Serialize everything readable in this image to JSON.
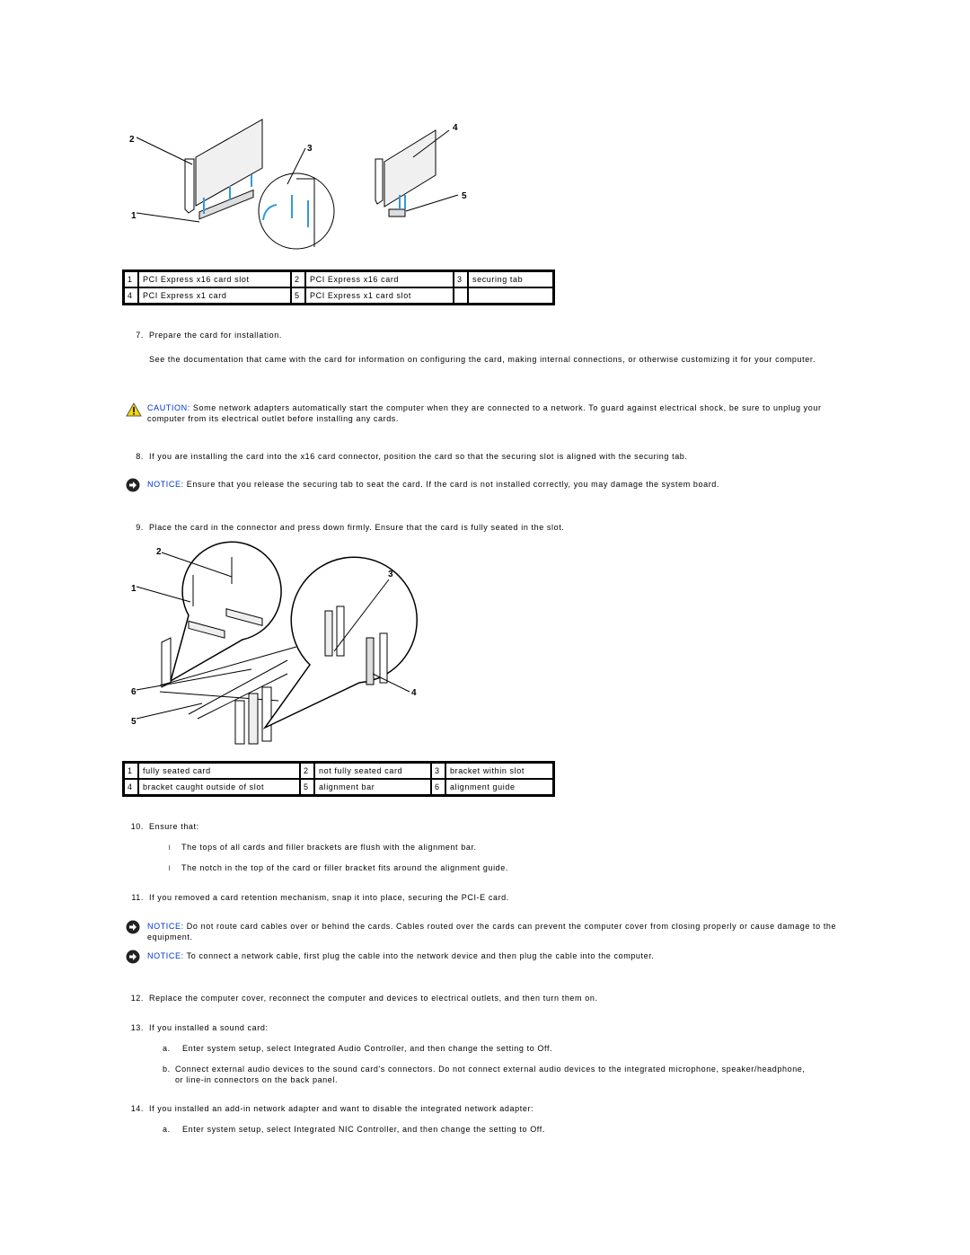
{
  "figure1": {
    "alt": "PCI Express x16 and x1 card installation diagram",
    "callouts": [
      "1",
      "2",
      "3",
      "4",
      "5"
    ]
  },
  "table1": {
    "rows": [
      [
        {
          "num": "1",
          "label": "PCI Express x16 card slot"
        },
        {
          "num": "2",
          "label": "PCI Express x16 card"
        },
        {
          "num": "3",
          "label": "securing tab"
        }
      ],
      [
        {
          "num": "4",
          "label": "PCI Express x1 card"
        },
        {
          "num": "5",
          "label": "PCI Express x1 card slot"
        },
        {
          "num": "",
          "label": ""
        }
      ]
    ]
  },
  "step7": {
    "num": "7.",
    "text": "Prepare the card for installation.",
    "detail": "See the documentation that came with the card for information on configuring the card, making internal connections, or otherwise customizing it for your computer."
  },
  "caution1": {
    "icon": "warning-triangle-icon",
    "label": "CAUTION:",
    "text": " Some network adapters automatically start the computer when they are connected to a network. To guard against electrical shock, be sure to unplug your computer from its electrical outlet before installing any cards."
  },
  "step8": {
    "num": "8.",
    "text": "If you are installing the card into the x16 card connector, position the card so that the securing slot is aligned with the securing tab."
  },
  "notice1": {
    "icon": "notice-arrow-icon",
    "label": "NOTICE:",
    "text": " Ensure that you release the securing tab to seat the card. If the card is not installed correctly, you may damage the system board."
  },
  "step9": {
    "num": "9.",
    "text": "Place the card in the connector and press down firmly. Ensure that the card is fully seated in the slot."
  },
  "figure2": {
    "alt": "Card seating and bracket alignment diagram",
    "callouts": [
      "1",
      "2",
      "3",
      "4",
      "5",
      "6"
    ]
  },
  "table2": {
    "rows": [
      [
        {
          "num": "1",
          "label": "fully seated card"
        },
        {
          "num": "2",
          "label": "not fully seated card"
        },
        {
          "num": "3",
          "label": "bracket within slot"
        }
      ],
      [
        {
          "num": "4",
          "label": "bracket caught outside of slot"
        },
        {
          "num": "5",
          "label": "alignment bar"
        },
        {
          "num": "6",
          "label": "alignment guide"
        }
      ]
    ]
  },
  "step10": {
    "num": "10.",
    "text": "Ensure that:",
    "bullets": [
      "The tops of all cards and filler brackets are flush with the alignment bar.",
      "The notch in the top of the card or filler bracket fits around the alignment guide."
    ],
    "bullet_glyph": "l"
  },
  "step11": {
    "num": "11.",
    "text": "If you removed a card retention mechanism, snap it into place, securing the PCI-E card."
  },
  "notice2": {
    "icon": "notice-arrow-icon",
    "label": "NOTICE:",
    "text": " Do not route card cables over or behind the cards. Cables routed over the cards can prevent the computer cover from closing properly or cause damage to the equipment."
  },
  "notice3": {
    "icon": "notice-arrow-icon",
    "label": "NOTICE:",
    "text": " To connect a network cable, first plug the cable into the network device and then plug the cable into the computer."
  },
  "step12": {
    "num": "12.",
    "text": "Replace the computer cover, reconnect the computer and devices to electrical outlets, and then turn them on."
  },
  "step13": {
    "num": "13.",
    "text": "If you installed a sound card:",
    "subs": [
      {
        "letter": "a.",
        "text": "Enter system setup, select Integrated Audio Controller, and then change the setting to Off."
      },
      {
        "letter": "b.",
        "text": "Connect external audio devices to the sound card's connectors. Do not connect external audio devices to the integrated microphone, speaker/headphone, or line-in connectors on the back panel."
      }
    ]
  },
  "step14": {
    "num": "14.",
    "text": "If you installed an add-in network adapter and want to disable the integrated network adapter:",
    "subs": [
      {
        "letter": "a.",
        "text": "Enter system setup, select Integrated NIC Controller, and then change the setting to Off."
      }
    ]
  },
  "colors": {
    "label_blue": "#0033cc",
    "arrow_blue": "#3399dd",
    "warning_yellow": "#f5d800"
  }
}
